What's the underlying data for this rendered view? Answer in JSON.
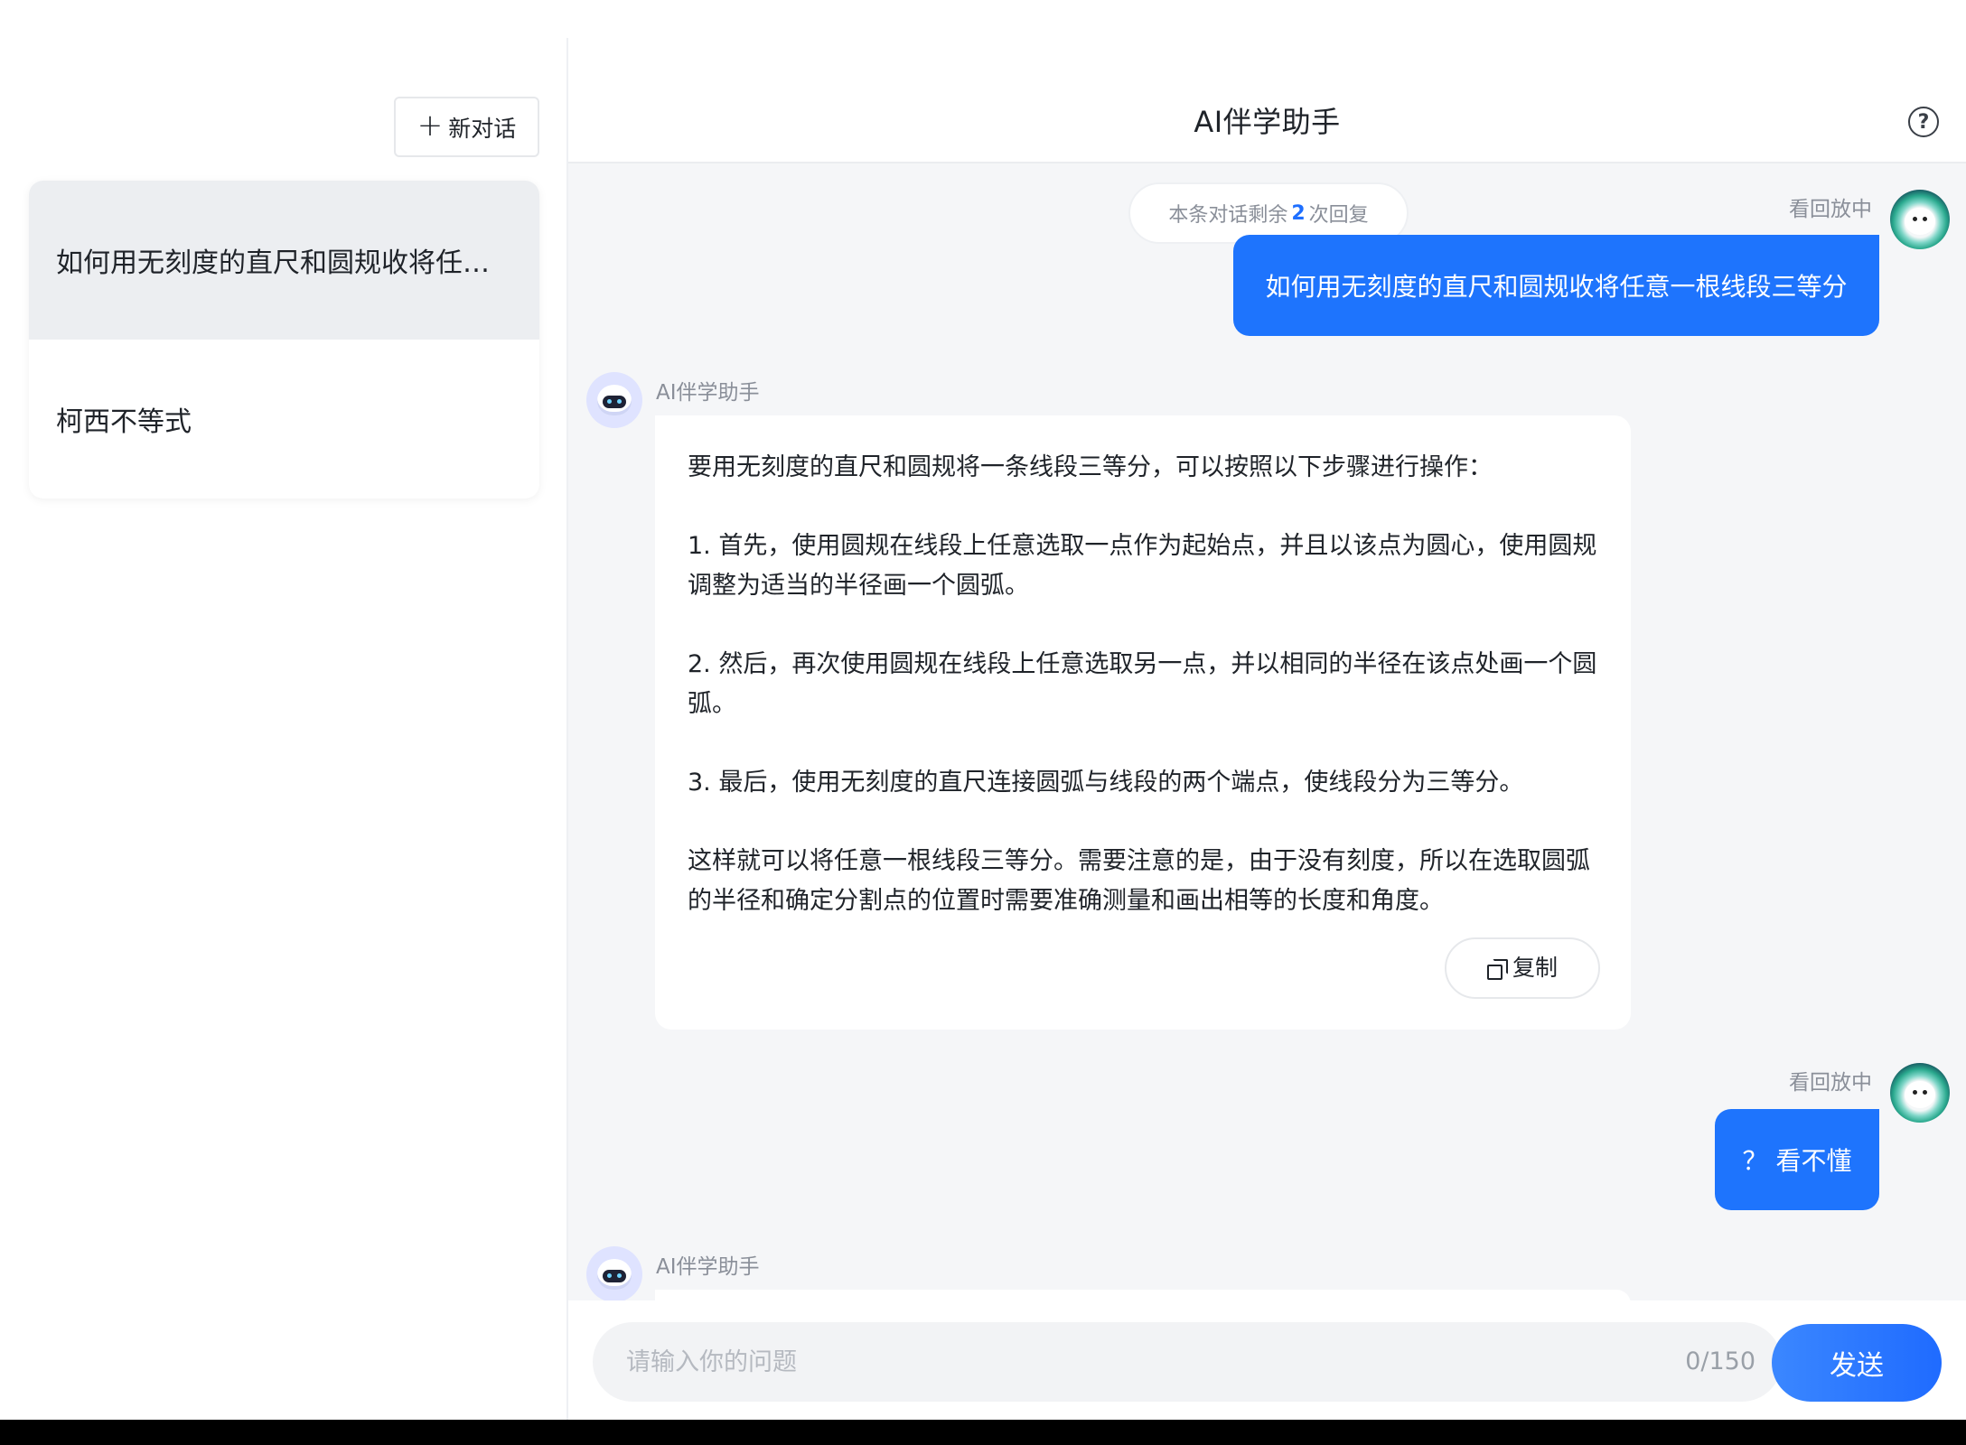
{
  "sidebar": {
    "new_chat_label": "新对话",
    "conversations": [
      {
        "title": "如何用无刻度的直尺和圆规收将任意..."
      },
      {
        "title": "柯西不等式"
      }
    ]
  },
  "header": {
    "title": "AI伴学助手"
  },
  "chat": {
    "remaining_prefix": "本条对话剩余",
    "remaining_count": "2",
    "remaining_suffix": "次回复",
    "user_name": "看回放中",
    "bot_name": "AI伴学助手",
    "messages": [
      {
        "role": "user",
        "text": "如何用无刻度的直尺和圆规收将任意一根线段三等分"
      },
      {
        "role": "bot",
        "paragraphs": [
          "要用无刻度的直尺和圆规将一条线段三等分，可以按照以下步骤进行操作：",
          "1. 首先，使用圆规在线段上任意选取一点作为起始点，并且以该点为圆心，使用圆规调整为适当的半径画一个圆弧。",
          "2. 然后，再次使用圆规在线段上任意选取另一点，并以相同的半径在该点处画一个圆弧。",
          "3. 最后，使用无刻度的直尺连接圆弧与线段的两个端点，使线段分为三等分。",
          "这样就可以将任意一根线段三等分。需要注意的是，由于没有刻度，所以在选取圆弧的半径和确定分割点的位置时需要准确测量和画出相等的长度和角度。"
        ],
        "copy_label": "复制"
      },
      {
        "role": "user",
        "text": "？ 看不懂"
      },
      {
        "role": "bot",
        "paragraphs": []
      }
    ]
  },
  "input": {
    "placeholder": "请输入你的问题",
    "counter": "0/150",
    "send_label": "发送"
  }
}
